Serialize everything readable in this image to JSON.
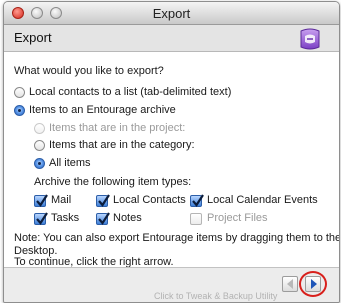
{
  "window": {
    "title": "Export"
  },
  "header": {
    "title": "Export"
  },
  "content": {
    "question": "What would you like to export?",
    "option_contacts": "Local contacts to a list (tab-delimited text)",
    "option_archive": "Items to an Entourage archive",
    "sub_project": "Items that are in the project:",
    "sub_category": "Items that are in the category:",
    "sub_all": "All items",
    "types_label": "Archive the following item types:",
    "types": {
      "mail": "Mail",
      "local_contacts": "Local Contacts",
      "local_calendar": "Local Calendar Events",
      "tasks": "Tasks",
      "notes": "Notes",
      "project_files": "Project Files"
    },
    "note_line1": "Note: You can also export Entourage items by dragging them to the",
    "note_line2": "Desktop.",
    "continue_text": "To continue, click the right arrow."
  },
  "footer": {
    "background_text": "Click to Tweak & Backup Utility"
  },
  "colors": {
    "accent": "#2a62c2",
    "highlight_circle": "#d8201c"
  }
}
